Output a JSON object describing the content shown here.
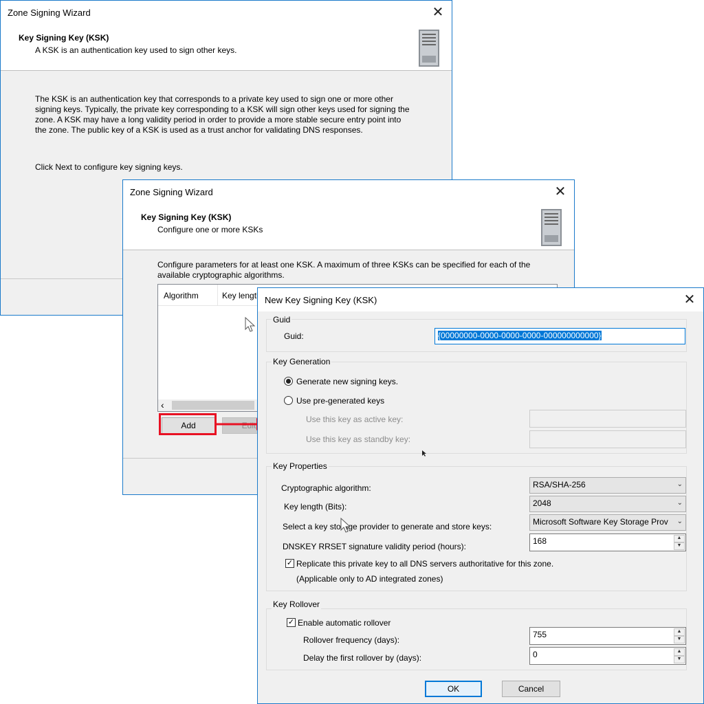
{
  "wizard1": {
    "title": "Zone Signing Wizard",
    "header_title": "Key Signing Key (KSK)",
    "header_sub": "A KSK is an authentication key used to sign other keys.",
    "body": "The KSK is an authentication key that corresponds to a private key used to sign one or more other signing keys. Typically, the private key corresponding to a KSK will sign other keys used for signing the zone. A KSK may have a long validity period in order to provide a more stable secure entry point into the zone. The public key of a KSK is used as a trust anchor for validating DNS responses.",
    "next_hint": "Click Next to configure key signing keys.",
    "close": "✕"
  },
  "wizard2": {
    "title": "Zone Signing Wizard",
    "header_title": "Key Signing Key (KSK)",
    "header_sub": "Configure one or more KSKs",
    "intro": "Configure parameters for at least one KSK. A maximum of three KSKs can be specified for each of the available cryptographic algorithms.",
    "columns": [
      "Algorithm",
      "Key length"
    ],
    "scroll_left": "‹",
    "add": "Add",
    "edit": "Edit",
    "close": "✕"
  },
  "dialog": {
    "title": "New Key Signing Key (KSK)",
    "close": "✕",
    "guid_group": "Guid",
    "guid_label": "Guid:",
    "guid_value": "{00000000-0000-0000-0000-000000000000}",
    "keygen_group": "Key Generation",
    "radio_new": "Generate new signing keys.",
    "radio_pre": "Use pre-generated keys",
    "active_label": "Use this key as active key:",
    "standby_label": "Use this key as standby key:",
    "props_group": "Key Properties",
    "algo_label": "Cryptographic algorithm:",
    "algo_value": "RSA/SHA-256",
    "len_label": "Key length (Bits):",
    "len_value": "2048",
    "ksp_label": "Select a key storage provider to generate and store keys:",
    "ksp_value": "Microsoft Software Key Storage Prov",
    "validity_label": "DNSKEY RRSET signature validity period (hours):",
    "validity_value": "168",
    "replicate_label": "Replicate this private key to all DNS servers authoritative for this zone.",
    "replicate_note": "(Applicable only to AD integrated zones)",
    "rollover_group": "Key Rollover",
    "auto_rollover": "Enable automatic rollover",
    "freq_label": "Rollover frequency (days):",
    "freq_value": "755",
    "delay_label": "Delay the first rollover by (days):",
    "delay_value": "0",
    "ok": "OK",
    "cancel": "Cancel"
  },
  "colors": {
    "accent": "#1979ca",
    "highlight": "#e81123",
    "selection": "#0078d7"
  }
}
